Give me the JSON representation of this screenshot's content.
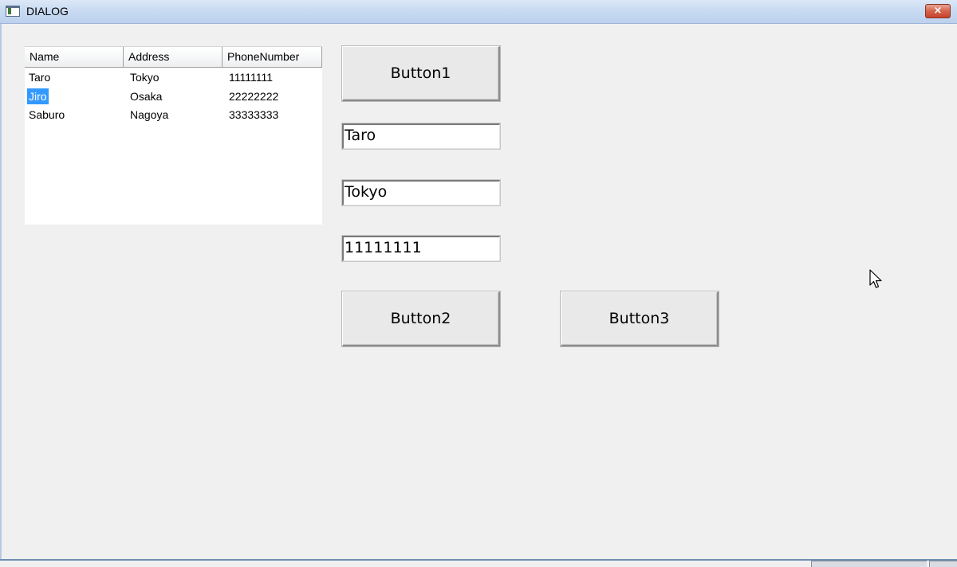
{
  "window": {
    "title": "DIALOG",
    "close_label": "×",
    "icon": "window-app-icon"
  },
  "listview": {
    "columns": [
      "Name",
      "Address",
      "PhoneNumber"
    ],
    "rows": [
      {
        "name": "Taro",
        "address": "Tokyo",
        "phone": "11111111",
        "selected": false
      },
      {
        "name": "Jiro",
        "address": "Osaka",
        "phone": "22222222",
        "selected": true
      },
      {
        "name": "Saburo",
        "address": "Nagoya",
        "phone": "33333333",
        "selected": false
      }
    ],
    "selection_color": "#3399ff"
  },
  "buttons": {
    "button1": "Button1",
    "button2": "Button2",
    "button3": "Button3"
  },
  "fields": {
    "name_value": "Taro",
    "address_value": "Tokyo",
    "phone_value": "11111111"
  },
  "colors": {
    "background": "#f0f0f0",
    "titlebar": "#c9dbf2",
    "close": "#c5432b"
  }
}
